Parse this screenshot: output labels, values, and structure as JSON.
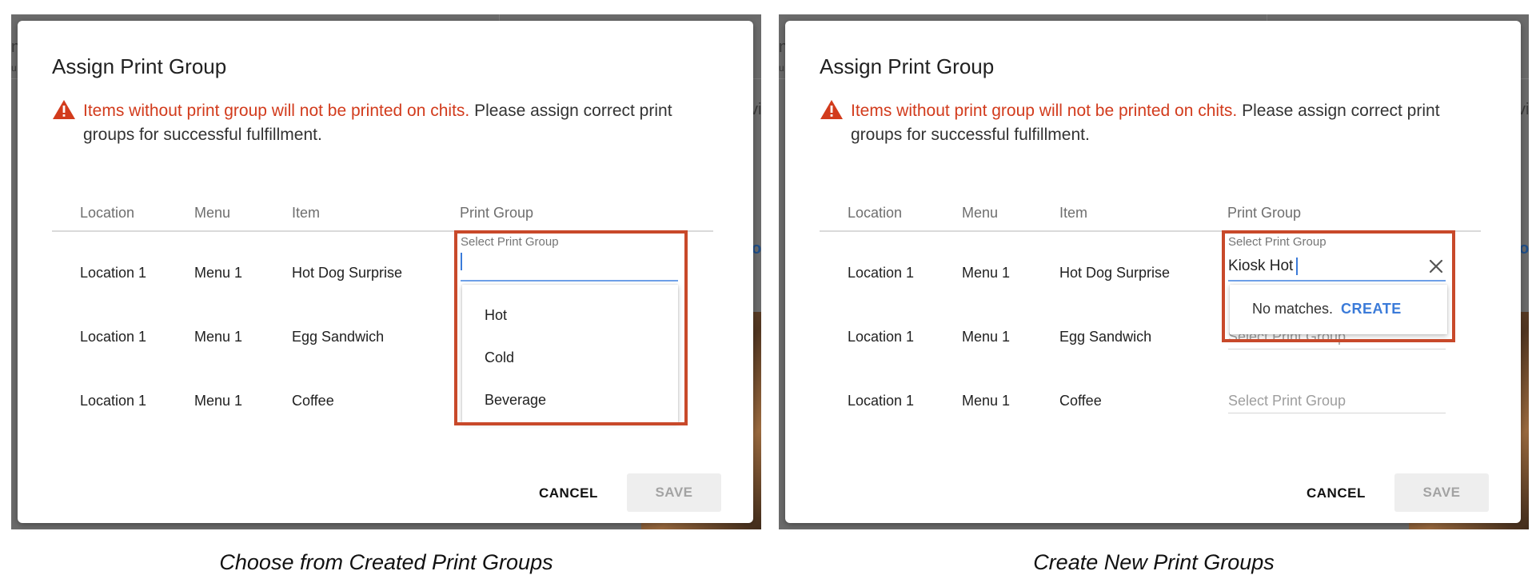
{
  "panels": {
    "left": {
      "dialog_title": "Assign Print Group",
      "warning_strong": "Items without print group will not be printed on chits.",
      "warning_rest": " Please assign correct print groups for successful fulfillment.",
      "columns": [
        "Location",
        "Menu",
        "Item",
        "Print Group"
      ],
      "rows": [
        {
          "location": "Location 1",
          "menu": "Menu 1",
          "item": "Hot Dog Surprise"
        },
        {
          "location": "Location 1",
          "menu": "Menu 1",
          "item": "Egg Sandwich"
        },
        {
          "location": "Location 1",
          "menu": "Menu 1",
          "item": "Coffee"
        }
      ],
      "select_label": "Select Print Group",
      "select_value": "",
      "options": [
        "Hot",
        "Cold",
        "Beverage"
      ],
      "cancel_label": "CANCEL",
      "save_label": "SAVE",
      "caption": "Choose from Created Print Groups"
    },
    "right": {
      "dialog_title": "Assign Print Group",
      "warning_strong": "Items without print group will not be printed on chits.",
      "warning_rest": " Please assign correct print groups for successful fulfillment.",
      "columns": [
        "Location",
        "Menu",
        "Item",
        "Print Group"
      ],
      "rows": [
        {
          "location": "Location 1",
          "menu": "Menu 1",
          "item": "Hot Dog Surprise"
        },
        {
          "location": "Location 1",
          "menu": "Menu 1",
          "item": "Egg Sandwich"
        },
        {
          "location": "Location 1",
          "menu": "Menu 1",
          "item": "Coffee"
        }
      ],
      "select_label": "Select Print Group",
      "select_value": "Kiosk Hot",
      "no_matches": "No matches.",
      "create_label": "CREATE",
      "row_placeholder": "Select Print Group",
      "cancel_label": "CANCEL",
      "save_label": "SAVE",
      "caption": "Create New Print Groups"
    }
  },
  "background_fragments": {
    "left": [
      "n",
      "u",
      "vi",
      "o"
    ],
    "right": [
      "n",
      "u",
      "vi",
      "o"
    ]
  },
  "colors": {
    "warning": "#d23b1c",
    "highlight": "#c8492a",
    "focus_underline": "#6ea0e8",
    "create_link": "#3b7bd9"
  },
  "icons": {
    "warning": "warning-triangle-icon",
    "clear": "close-icon"
  }
}
